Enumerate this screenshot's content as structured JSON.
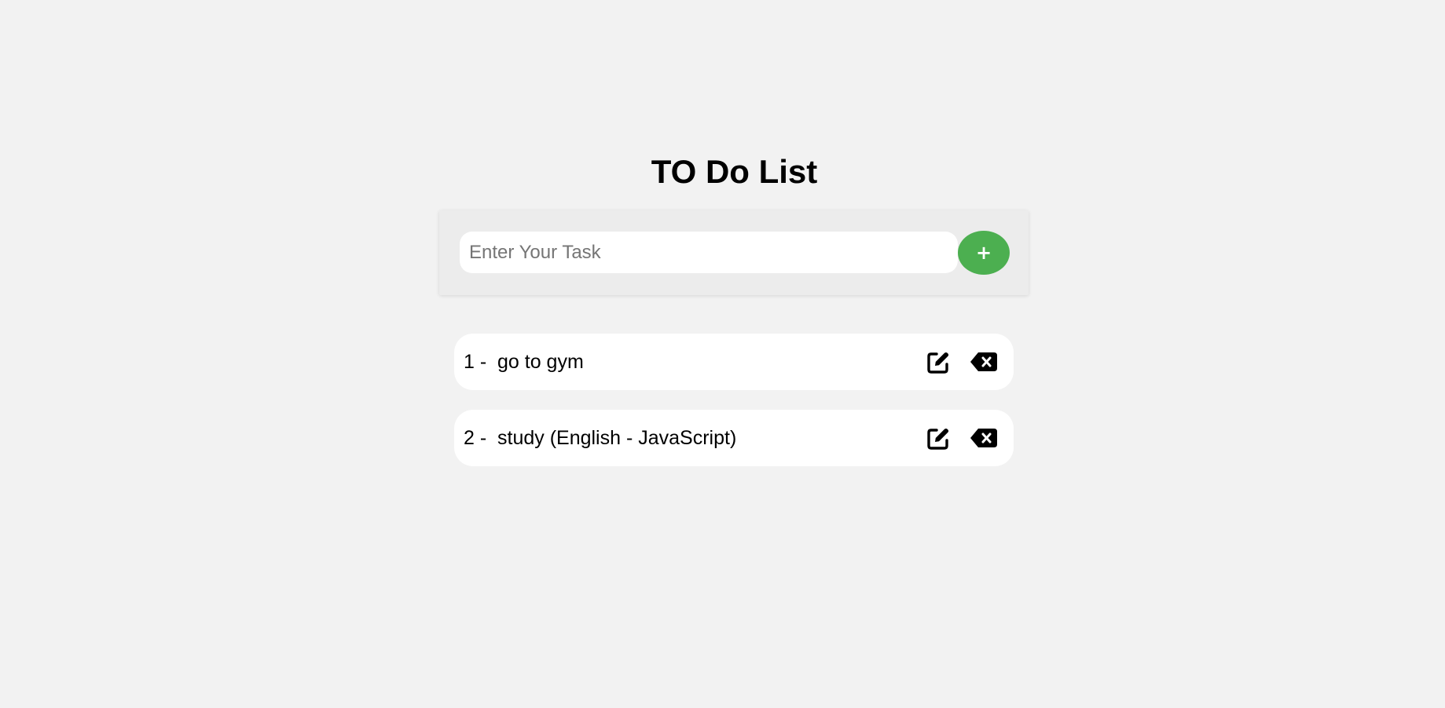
{
  "app": {
    "title": "TO Do List"
  },
  "input": {
    "placeholder": "Enter Your Task",
    "value": ""
  },
  "add_button": {
    "label": "+",
    "icon": "plus-icon",
    "color": "#4caf50"
  },
  "tasks": [
    {
      "number": "1 -",
      "text": "go to gym",
      "edit_icon": "edit-icon",
      "delete_icon": "backspace-delete-icon"
    },
    {
      "number": "2 -",
      "text": "study (English - JavaScript)",
      "edit_icon": "edit-icon",
      "delete_icon": "backspace-delete-icon"
    }
  ],
  "colors": {
    "background": "#f2f2f2",
    "panel": "#ececec",
    "accent": "#4caf50",
    "text": "#000000"
  }
}
